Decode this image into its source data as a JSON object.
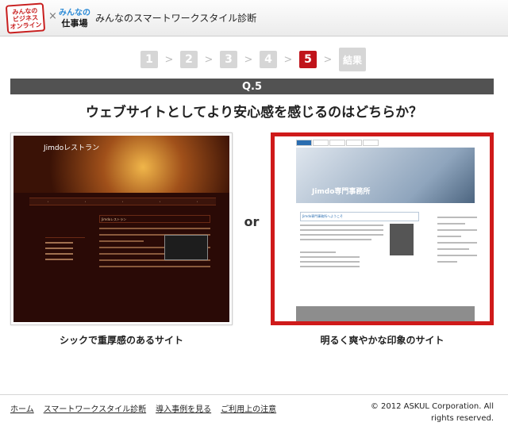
{
  "header": {
    "logo1_lines": [
      "みんなの",
      "ビジネス",
      "オンライン"
    ],
    "separator": "×",
    "logo2_top": "みんなの",
    "logo2_bottom": "仕事場",
    "app_title": "みんなのスマートワークスタイル診断"
  },
  "steps": {
    "items": [
      "1",
      "2",
      "3",
      "4",
      "5"
    ],
    "active_index": 4,
    "result_label": "結果",
    "arrow": ">"
  },
  "question": {
    "number": "Q.5",
    "text": "ウェブサイトとしてより安心感を感じるのはどちらか？"
  },
  "options": {
    "or_label": "or",
    "a": {
      "caption": "シックで重厚感のあるサイト",
      "preview_title": "Jimdoレストラン",
      "preview_heading": "Jimdoレストラン",
      "selected": false
    },
    "b": {
      "caption": "明るく爽やかな印象のサイト",
      "preview_title": "Jimdo専門事務所",
      "preview_heading": "Jimdo専門事務所へようこそ",
      "selected": true
    }
  },
  "footer": {
    "links": [
      "ホーム",
      "スマートワークスタイル診断",
      "導入事例を見る",
      "ご利用上の注意"
    ],
    "copyright_line1": "© 2012 ASKUL Corporation. All",
    "copyright_line2": "rights reserved."
  },
  "colors": {
    "accent_red": "#c0141b",
    "qbar": "#525252",
    "step_inactive": "#d6d6d6"
  }
}
